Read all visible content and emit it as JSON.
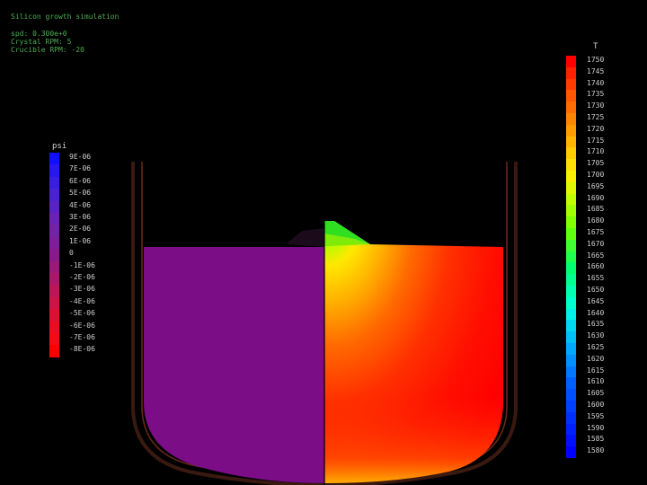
{
  "header": {
    "title": "Silicon growth simulation",
    "line2": "spd: 0.300e+0",
    "line3": "Crystal RPM: 5",
    "line4": "Crucible RPM: -20"
  },
  "psi_legend": {
    "title": "psi",
    "labels": [
      "9E-06",
      "7E-06",
      "6E-06",
      "5E-06",
      "4E-06",
      "3E-06",
      "2E-06",
      "1E-06",
      "0",
      "-1E-06",
      "-2E-06",
      "-3E-06",
      "-4E-06",
      "-5E-06",
      "-6E-06",
      "-7E-06",
      "-8E-06"
    ],
    "colors": [
      "#1010ff",
      "#2818ef",
      "#3a1ee0",
      "#4a22d0",
      "#5a22c2",
      "#6a22b4",
      "#7622a6",
      "#7e1e9c",
      "#8a1a8c",
      "#9a1a7c",
      "#aa186a",
      "#bb1658",
      "#cc1446",
      "#dd1034",
      "#ec0c22",
      "#f60a14",
      "#ff0000"
    ]
  },
  "t_legend": {
    "title": "T",
    "labels": [
      "1750",
      "1745",
      "1740",
      "1735",
      "1730",
      "1725",
      "1720",
      "1715",
      "1710",
      "1705",
      "1700",
      "1695",
      "1690",
      "1685",
      "1680",
      "1675",
      "1670",
      "1665",
      "1660",
      "1655",
      "1650",
      "1645",
      "1640",
      "1635",
      "1630",
      "1625",
      "1620",
      "1615",
      "1610",
      "1605",
      "1600",
      "1595",
      "1590",
      "1585",
      "1580"
    ],
    "colors": [
      "#ff0000",
      "#ff2200",
      "#ff3c00",
      "#ff5600",
      "#ff6c00",
      "#ff8400",
      "#ff9c00",
      "#ffb400",
      "#ffcc00",
      "#ffe000",
      "#f8f000",
      "#e0f800",
      "#c0ff00",
      "#a0ff00",
      "#80ff00",
      "#60ff10",
      "#40ff30",
      "#20ff50",
      "#00ff70",
      "#00ff90",
      "#00ffb0",
      "#00ffd0",
      "#00f0e8",
      "#00d8f0",
      "#00c0f8",
      "#00a8ff",
      "#0090ff",
      "#0078ff",
      "#0060ff",
      "#0050ff",
      "#0040ff",
      "#0030ff",
      "#0020ff",
      "#0010ff",
      "#0000ff"
    ]
  },
  "colors": {
    "psi_region": "#7b0d87",
    "crucible_wall": "#5a2a1a",
    "header_text": "#4caf50"
  }
}
